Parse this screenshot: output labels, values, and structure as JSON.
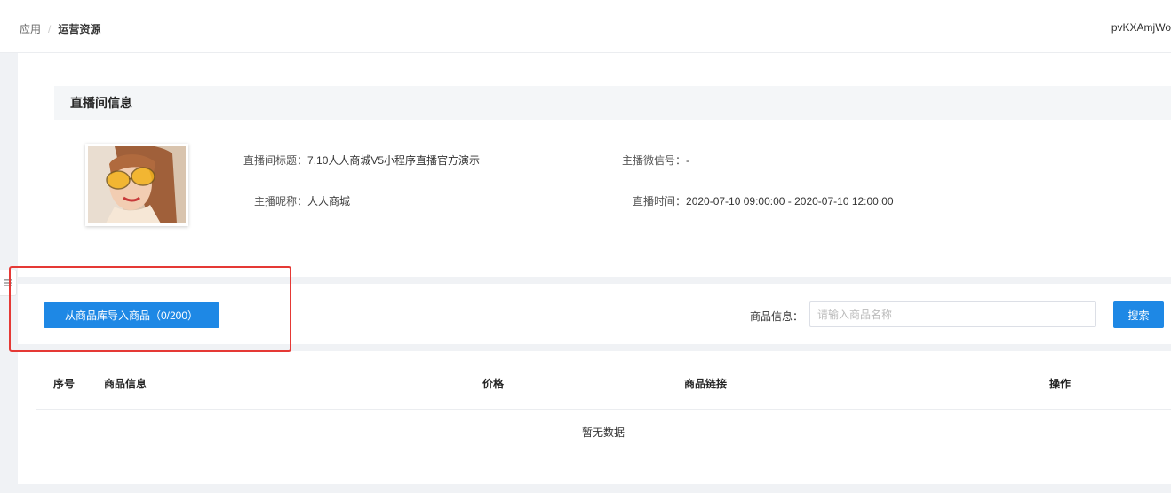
{
  "header": {
    "breadcrumb": [
      "应用",
      "运营资源"
    ],
    "breadcrumb_separator": "/",
    "user_name": "pvKXAmjWo"
  },
  "sidebar_toggle": {
    "icon": "menu-fold-icon",
    "glyph": "☰"
  },
  "room_info": {
    "section_title": "直播间信息",
    "cover_image": "live-room-cover-portrait",
    "fields": {
      "title_label": "直播间标题：",
      "title_value": "7.10人人商城V5小程序直播官方演示",
      "wechat_label": "主播微信号：",
      "wechat_value": "-",
      "nickname_label": "主播昵称：",
      "nickname_value": "人人商城",
      "time_label": "直播时间：",
      "time_value": "2020-07-10 09:00:00 - 2020-07-10 12:00:00"
    }
  },
  "toolbar": {
    "import_button": "从商品库导入商品（0/200）",
    "search_label": "商品信息：",
    "search_placeholder": "请输入商品名称",
    "search_value": "",
    "search_button": "搜索"
  },
  "table": {
    "columns": [
      "序号",
      "商品信息",
      "价格",
      "商品链接",
      "操作"
    ],
    "rows": [],
    "empty_text": "暂无数据"
  },
  "colors": {
    "primary": "#1e88e5",
    "highlight": "#e53935",
    "page_bg": "#f0f2f5"
  }
}
